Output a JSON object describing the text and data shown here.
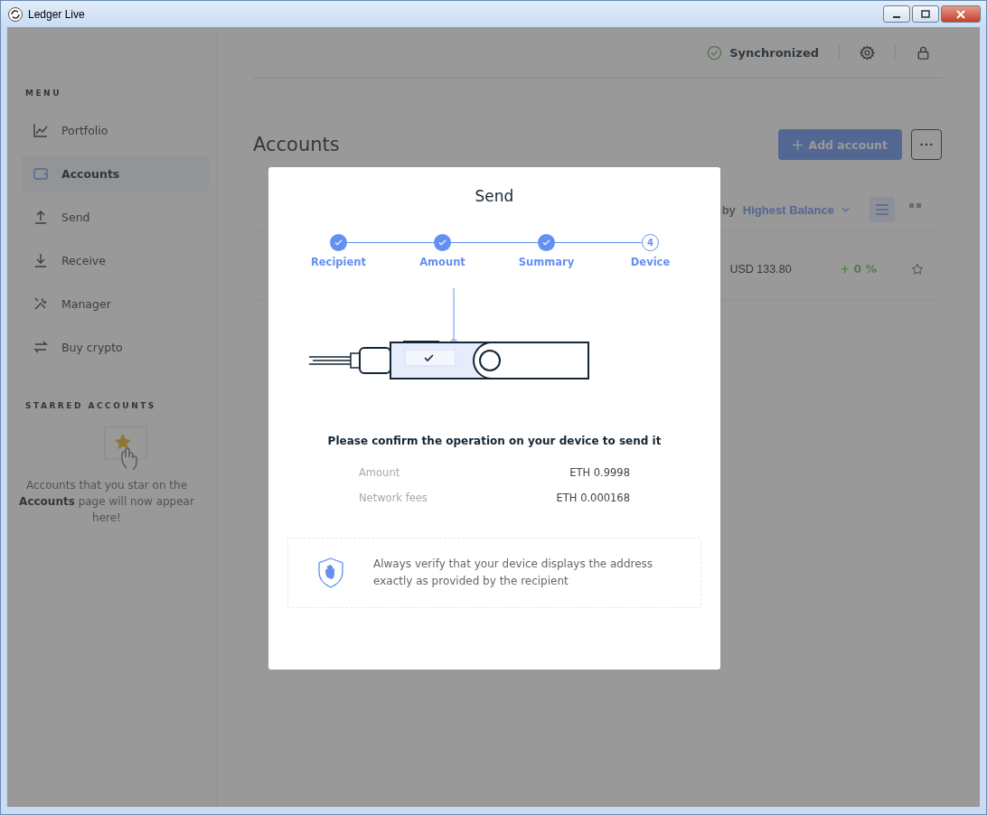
{
  "window": {
    "title": "Ledger Live"
  },
  "header": {
    "sync_status": "Synchronized"
  },
  "sidebar": {
    "menu_label": "MENU",
    "items": [
      {
        "label": "Portfolio",
        "selected": false
      },
      {
        "label": "Accounts",
        "selected": true
      },
      {
        "label": "Send",
        "selected": false
      },
      {
        "label": "Receive",
        "selected": false
      },
      {
        "label": "Manager",
        "selected": false
      },
      {
        "label": "Buy crypto",
        "selected": false
      }
    ],
    "starred_label": "STARRED ACCOUNTS",
    "starred_hint": "Accounts that you star on the **Accounts** page will now appear here!"
  },
  "page": {
    "title": "Accounts",
    "add_button": "Add account",
    "sort_prefix": "by",
    "sort_value": "Highest Balance",
    "row": {
      "balance": "USD 133.80",
      "change": "+ 0 %"
    }
  },
  "modal": {
    "title": "Send",
    "steps": [
      {
        "label": "Recipient",
        "done": true
      },
      {
        "label": "Amount",
        "done": true
      },
      {
        "label": "Summary",
        "done": true
      },
      {
        "label": "Device",
        "done": false,
        "number": "4"
      }
    ],
    "message": "Please confirm the operation on your device to send it",
    "details": [
      {
        "label": "Amount",
        "value": "ETH 0.9998"
      },
      {
        "label": "Network fees",
        "value": "ETH 0.000168"
      }
    ],
    "warning": "Always verify that your device displays the address exactly as provided by the recipient"
  }
}
